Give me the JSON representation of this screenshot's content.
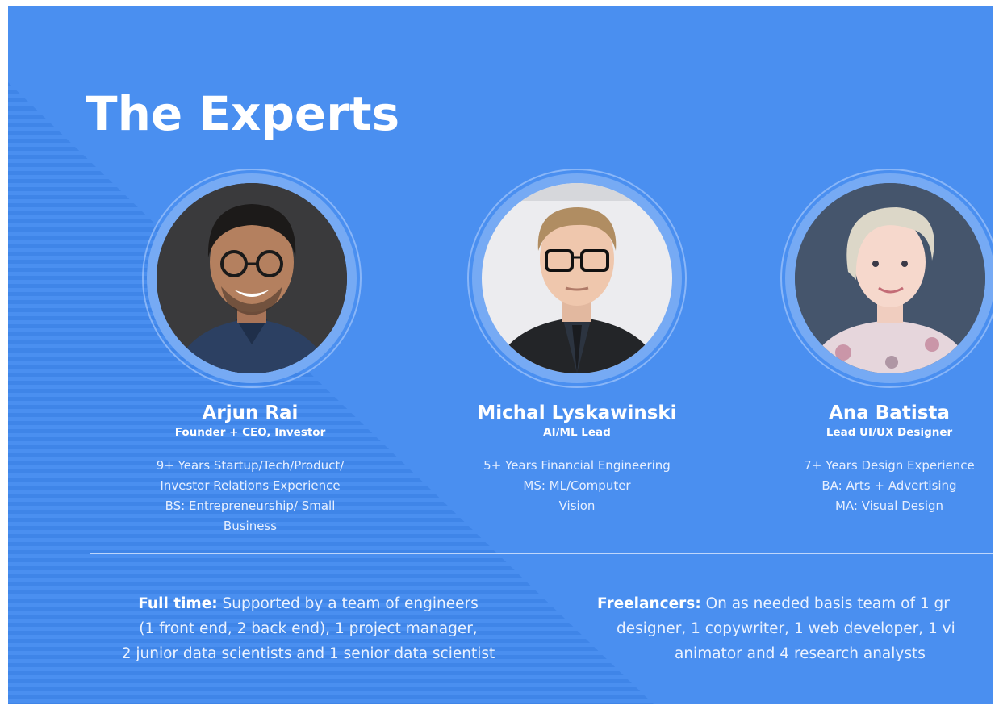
{
  "title": "The Experts",
  "team": [
    {
      "name": "Arjun Rai",
      "role": "Founder + CEO, Investor",
      "bio": [
        "9+ Years Startup/Tech/Product/",
        "Investor Relations Experience",
        "BS: Entrepreneurship/ Small",
        "Business"
      ]
    },
    {
      "name": "Michal Lyskawinski",
      "role": "AI/ML Lead",
      "bio": [
        "5+ Years Financial Engineering",
        "MS: ML/Computer",
        "Vision"
      ]
    },
    {
      "name": "Ana Batista",
      "role": "Lead UI/UX Designer",
      "bio": [
        "7+ Years Design Experience",
        "BA: Arts + Advertising",
        "MA: Visual Design"
      ]
    }
  ],
  "footer": {
    "fulltime": {
      "label": "Full time:",
      "lines": [
        "Supported by a team of engineers",
        "(1 front end, 2 back end), 1 project manager,",
        "2 junior data scientists and 1 senior data scientist"
      ]
    },
    "freelancers": {
      "label": "Freelancers:",
      "lines": [
        "On as needed basis team of 1 gr",
        "designer, 1 copywriter, 1 web developer, 1 vi",
        "animator and 4 research analysts"
      ]
    }
  },
  "colors": {
    "background": "#4a8ff0",
    "stripe": "#3f85e8",
    "text": "#ffffff"
  }
}
